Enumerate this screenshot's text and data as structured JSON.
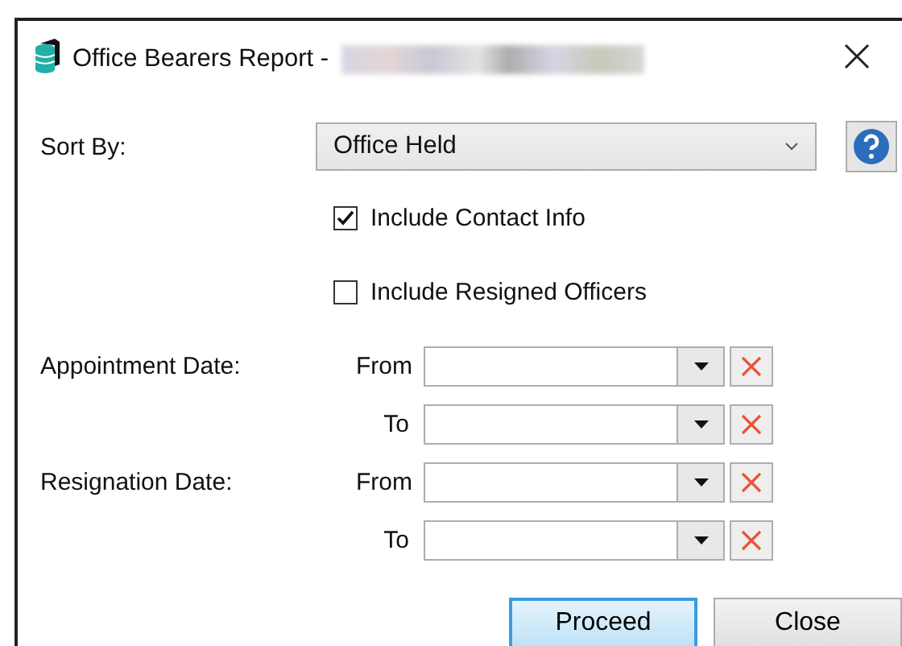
{
  "window": {
    "title": "Office Bearers Report -",
    "title_redacted": true
  },
  "sort_by": {
    "label": "Sort By:",
    "value": "Office Held"
  },
  "options": [
    {
      "label": "Include Contact Info",
      "checked": true
    },
    {
      "label": "Include Resigned Officers",
      "checked": false
    }
  ],
  "date_groups": [
    {
      "label": "Appointment Date:",
      "rows": [
        {
          "label": "From",
          "value": ""
        },
        {
          "label": "To",
          "value": ""
        }
      ]
    },
    {
      "label": "Resignation Date:",
      "rows": [
        {
          "label": "From",
          "value": ""
        },
        {
          "label": "To",
          "value": ""
        }
      ]
    }
  ],
  "buttons": [
    {
      "label": "Proceed",
      "default": true
    },
    {
      "label": "Close",
      "default": false
    }
  ]
}
